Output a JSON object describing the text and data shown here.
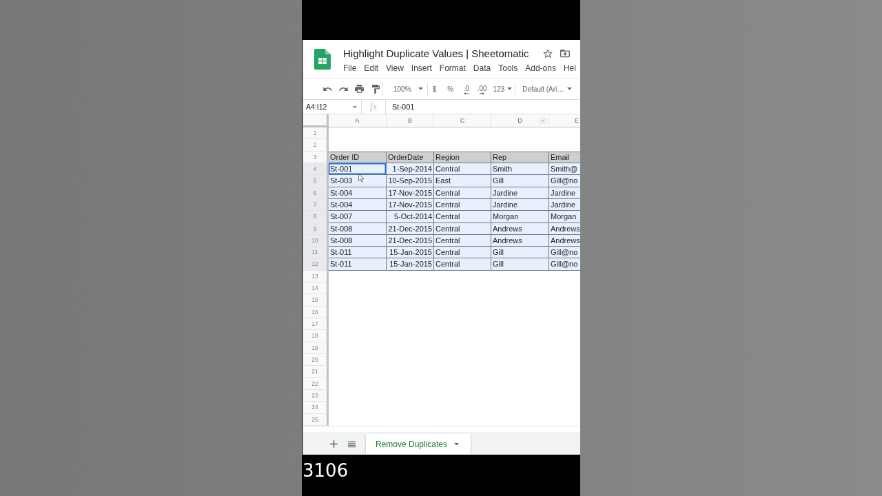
{
  "spreadsheet": {
    "title": "Highlight Duplicate Values | Sheetomatic",
    "menu": [
      "File",
      "Edit",
      "View",
      "Insert",
      "Format",
      "Data",
      "Tools",
      "Add-ons",
      "Hel"
    ],
    "toolbar": {
      "zoom": "100%",
      "buttons": [
        {
          "label": "$",
          "kind": "plain"
        },
        {
          "label": "%",
          "kind": "plain"
        },
        {
          "label": ".0",
          "kind": "decrease"
        },
        {
          "label": ".00",
          "kind": "increase"
        }
      ],
      "number_format": "123",
      "font": "Default (Ari…"
    },
    "formula_bar": {
      "name_box": "A4:I12",
      "function_label": "fx",
      "formula": "St-001"
    },
    "sheet": {
      "columns": [
        {
          "label": "A",
          "menu": false,
          "kind": "text"
        },
        {
          "label": "B",
          "menu": false,
          "kind": "date"
        },
        {
          "label": "C",
          "menu": false,
          "kind": "text"
        },
        {
          "label": "D",
          "menu": true,
          "kind": "text"
        },
        {
          "label": "E",
          "menu": false,
          "kind": "text"
        }
      ],
      "rows": [
        {
          "number": "1",
          "kind": "empty",
          "selected": false
        },
        {
          "number": "2",
          "kind": "empty",
          "selected": false
        },
        {
          "number": "3",
          "kind": "header",
          "selected": false,
          "cells": [
            {
              "text": "Order ID",
              "active": false
            },
            {
              "text": "OrderDate",
              "active": false
            },
            {
              "text": "Region",
              "active": false
            },
            {
              "text": "Rep",
              "active": false
            },
            {
              "text": "Email",
              "active": false
            }
          ]
        },
        {
          "number": "4",
          "kind": "data",
          "selected": true,
          "cells": [
            {
              "text": "St-001",
              "active": true
            },
            {
              "text": "1-Sep-2014",
              "active": false
            },
            {
              "text": "Central",
              "active": false
            },
            {
              "text": "Smith",
              "active": false
            },
            {
              "text": "Smith@",
              "active": false
            }
          ]
        },
        {
          "number": "5",
          "kind": "data",
          "selected": true,
          "cells": [
            {
              "text": "St-003",
              "active": false
            },
            {
              "text": "10-Sep-2015",
              "active": false
            },
            {
              "text": "East",
              "active": false
            },
            {
              "text": "Gill",
              "active": false
            },
            {
              "text": "Gill@no",
              "active": false
            }
          ]
        },
        {
          "number": "6",
          "kind": "data",
          "selected": true,
          "cells": [
            {
              "text": "St-004",
              "active": false
            },
            {
              "text": "17-Nov-2015",
              "active": false
            },
            {
              "text": "Central",
              "active": false
            },
            {
              "text": "Jardine",
              "active": false
            },
            {
              "text": "Jardine",
              "active": false
            }
          ]
        },
        {
          "number": "7",
          "kind": "data",
          "selected": true,
          "cells": [
            {
              "text": "St-004",
              "active": false
            },
            {
              "text": "17-Nov-2015",
              "active": false
            },
            {
              "text": "Central",
              "active": false
            },
            {
              "text": "Jardine",
              "active": false
            },
            {
              "text": "Jardine",
              "active": false
            }
          ]
        },
        {
          "number": "8",
          "kind": "data",
          "selected": true,
          "cells": [
            {
              "text": "St-007",
              "active": false
            },
            {
              "text": "5-Oct-2014",
              "active": false
            },
            {
              "text": "Central",
              "active": false
            },
            {
              "text": "Morgan",
              "active": false
            },
            {
              "text": "Morgan",
              "active": false
            }
          ]
        },
        {
          "number": "9",
          "kind": "data",
          "selected": true,
          "cells": [
            {
              "text": "St-008",
              "active": false
            },
            {
              "text": "21-Dec-2015",
              "active": false
            },
            {
              "text": "Central",
              "active": false
            },
            {
              "text": "Andrews",
              "active": false
            },
            {
              "text": "Andrews",
              "active": false
            }
          ]
        },
        {
          "number": "10",
          "kind": "data",
          "selected": true,
          "cells": [
            {
              "text": "St-008",
              "active": false
            },
            {
              "text": "21-Dec-2015",
              "active": false
            },
            {
              "text": "Central",
              "active": false
            },
            {
              "text": "Andrews",
              "active": false
            },
            {
              "text": "Andrews",
              "active": false
            }
          ]
        },
        {
          "number": "11",
          "kind": "data",
          "selected": true,
          "cells": [
            {
              "text": "St-011",
              "active": false
            },
            {
              "text": "15-Jan-2015",
              "active": false
            },
            {
              "text": "Central",
              "active": false
            },
            {
              "text": "Gill",
              "active": false
            },
            {
              "text": "Gill@no",
              "active": false
            }
          ]
        },
        {
          "number": "12",
          "kind": "data",
          "selected": true,
          "cells": [
            {
              "text": "St-011",
              "active": false
            },
            {
              "text": "15-Jan-2015",
              "active": false
            },
            {
              "text": "Central",
              "active": false
            },
            {
              "text": "Gill",
              "active": false
            },
            {
              "text": "Gill@no",
              "active": false
            }
          ]
        },
        {
          "number": "13",
          "kind": "empty",
          "selected": false
        },
        {
          "number": "14",
          "kind": "empty",
          "selected": false
        },
        {
          "number": "15",
          "kind": "empty",
          "selected": false
        },
        {
          "number": "16",
          "kind": "empty",
          "selected": false
        },
        {
          "number": "17",
          "kind": "empty",
          "selected": false
        },
        {
          "number": "18",
          "kind": "empty",
          "selected": false
        },
        {
          "number": "19",
          "kind": "empty",
          "selected": false
        },
        {
          "number": "20",
          "kind": "empty",
          "selected": false
        },
        {
          "number": "21",
          "kind": "empty",
          "selected": false
        },
        {
          "number": "22",
          "kind": "empty",
          "selected": false
        },
        {
          "number": "23",
          "kind": "empty",
          "selected": false
        },
        {
          "number": "24",
          "kind": "empty",
          "selected": false
        },
        {
          "number": "25",
          "kind": "empty",
          "selected": false
        }
      ]
    },
    "sheet_tabs": [
      {
        "label": "Remove Duplicates",
        "selected": true
      }
    ]
  },
  "caption": "3106"
}
